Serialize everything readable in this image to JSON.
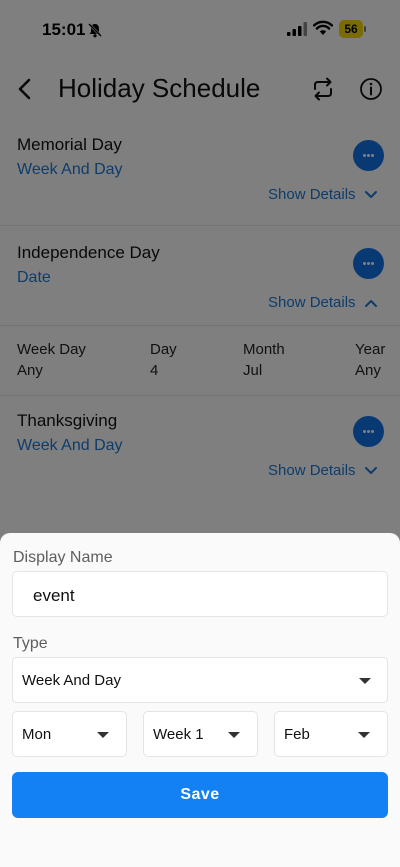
{
  "status_bar": {
    "time": "15:01",
    "battery": "56"
  },
  "header": {
    "title": "Holiday Schedule"
  },
  "holidays": [
    {
      "name": "Memorial Day",
      "type": "Week And Day",
      "show_details": "Show Details",
      "expanded": false
    },
    {
      "name": "Independence Day",
      "type": "Date",
      "show_details": "Show Details",
      "expanded": true,
      "details": {
        "headers": [
          "Week Day",
          "Day",
          "Month",
          "Year"
        ],
        "values": [
          "Any",
          "4",
          "Jul",
          "Any"
        ]
      }
    },
    {
      "name": "Thanksgiving",
      "type": "Week And Day",
      "show_details": "Show Details",
      "expanded": false
    }
  ],
  "sheet": {
    "display_name_label": "Display Name",
    "display_name_value": "event",
    "type_label": "Type",
    "type_value": "Week And Day",
    "weekday_value": "Mon",
    "week_value": "Week 1",
    "month_value": "Feb",
    "save_label": "Save"
  },
  "colors": {
    "accent": "#1381f4",
    "link": "#1d78d6",
    "battery": "#f5d800"
  }
}
